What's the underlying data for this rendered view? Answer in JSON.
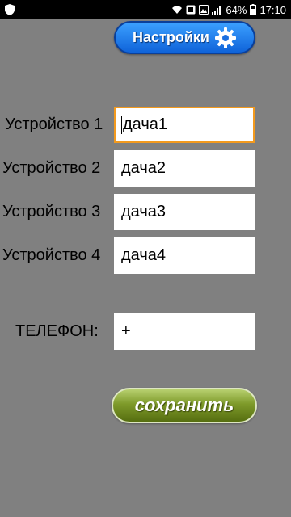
{
  "status_bar": {
    "battery": "64%",
    "time": "17:10",
    "icons": [
      "shield-icon",
      "wifi-icon",
      "notification-icon",
      "signal-icon",
      "battery-icon"
    ]
  },
  "settings_button": {
    "label": "Настройки",
    "icon": "gear-icon"
  },
  "devices": [
    {
      "label": "Устройство 1",
      "value": "дача1"
    },
    {
      "label": "Устройство  2",
      "value": "дача2"
    },
    {
      "label": "Устройство  3",
      "value": "дача3"
    },
    {
      "label": "Устройство  4",
      "value": "дача4"
    }
  ],
  "phone": {
    "label": "ТЕЛЕФОН:",
    "value": "+"
  },
  "save_button": {
    "label": "сохранить"
  },
  "colors": {
    "background": "#808080",
    "settings_button": "#1a75e8",
    "save_button": "#7e9a2a",
    "focus_border": "#f39a1e"
  }
}
